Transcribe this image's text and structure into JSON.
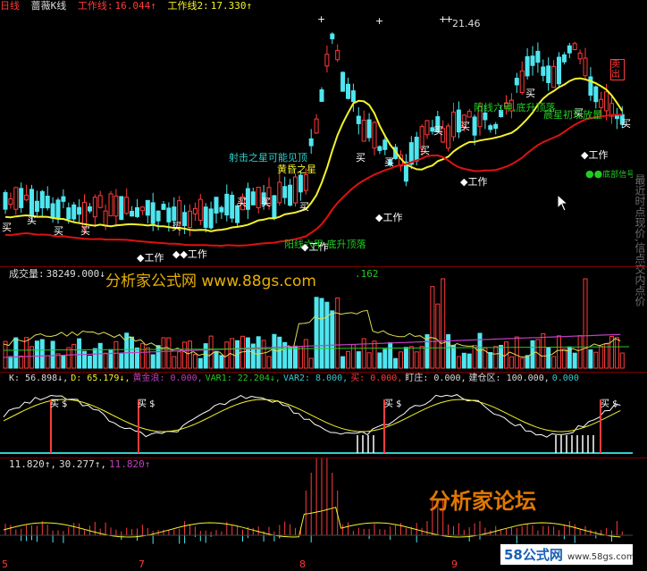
{
  "main": {
    "header": {
      "tag": "日线",
      "name": "蔷薇K线",
      "work1_label": "工作线:",
      "work1_value": "16.044↑",
      "work2_label": "工作线2:",
      "work2_value": "17.330↑"
    },
    "peak_label": "21.46",
    "annotations": {
      "shooting_star": "射击之星可能见顶",
      "evening_star": "黄昏之星",
      "sun_six": "阳线六甲,底升顶落",
      "morning_star": "晨星初现放量",
      "sell_tag": "卖出",
      "buy": "买",
      "work": "工作",
      "bottom_sign": "底部信号"
    },
    "side_text": "最近时点现价,信点交内点价"
  },
  "volume": {
    "header": {
      "title": "成交量:",
      "value": "38249.000↓",
      "ma_tail": ".162"
    },
    "watermark": "分析家公式网 www.88gs.com"
  },
  "kdj": {
    "header": {
      "k": "K: 56.898↓,",
      "d": "D: 65.179↓,",
      "gold": "黄金浪: 0.000,",
      "var1": "VAR1: 22.204↓,",
      "var2": "VAR2: 8.000,",
      "buy": "买: 0.000,",
      "dz": "盯庄: 0.000,",
      "jc": "建仓区: 100.000,",
      "last": "0.000"
    },
    "buy_marks": [
      "买 $",
      "买 $",
      "买 $",
      "买 $"
    ]
  },
  "osc": {
    "header": {
      "v1": "11.820↑,",
      "v2": "30.277↑,",
      "v3": "11.820↑"
    },
    "forum_watermark": "分析家论坛",
    "site_watermark": "58公式网",
    "site_url": "www.58gs.com",
    "axis_labels": [
      "5",
      "7",
      "8",
      "9"
    ]
  },
  "colors": {
    "up": "#ff3b3b",
    "down": "#4fe6f0",
    "yellow": "#f2f22a",
    "red_line": "#e01010",
    "green": "#22cc22",
    "magenta": "#c040c0",
    "cyan": "#33cccc"
  }
}
